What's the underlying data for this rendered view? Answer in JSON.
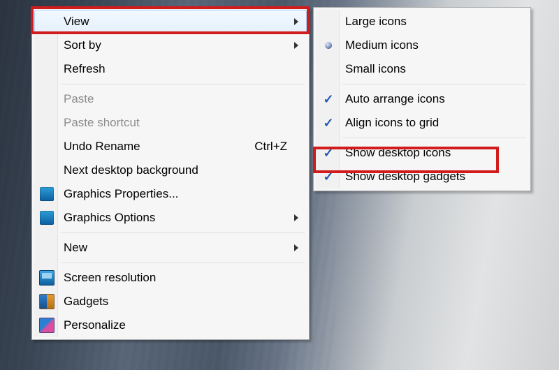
{
  "mainMenu": {
    "view": {
      "label": "View"
    },
    "sortBy": {
      "label": "Sort by"
    },
    "refresh": {
      "label": "Refresh"
    },
    "paste": {
      "label": "Paste"
    },
    "pasteShortcut": {
      "label": "Paste shortcut"
    },
    "undoRename": {
      "label": "Undo Rename",
      "shortcut": "Ctrl+Z"
    },
    "nextBg": {
      "label": "Next desktop background"
    },
    "gfxProps": {
      "label": "Graphics Properties..."
    },
    "gfxOptions": {
      "label": "Graphics Options"
    },
    "new": {
      "label": "New"
    },
    "screenRes": {
      "label": "Screen resolution"
    },
    "gadgets": {
      "label": "Gadgets"
    },
    "personalize": {
      "label": "Personalize"
    }
  },
  "subMenu": {
    "largeIcons": {
      "label": "Large icons"
    },
    "mediumIcons": {
      "label": "Medium icons",
      "selected": true
    },
    "smallIcons": {
      "label": "Small icons"
    },
    "autoArrange": {
      "label": "Auto arrange icons",
      "checked": true
    },
    "alignGrid": {
      "label": "Align icons to grid",
      "checked": true
    },
    "showIcons": {
      "label": "Show desktop icons",
      "checked": true
    },
    "showGadgets": {
      "label": "Show desktop gadgets",
      "checked": true
    }
  }
}
